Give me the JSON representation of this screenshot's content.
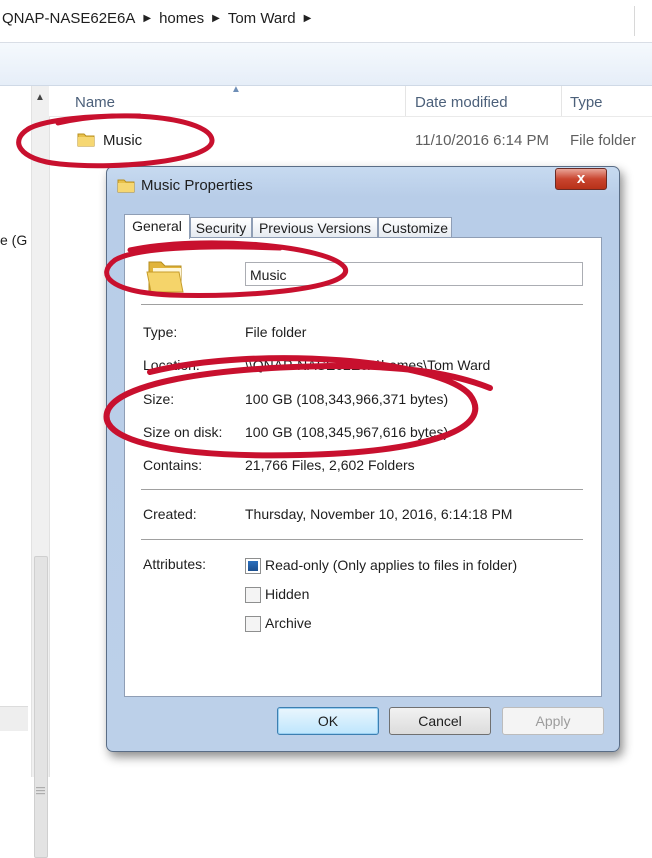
{
  "address": {
    "crumbs": [
      "QNAP-NASE62E6A",
      "homes",
      "Tom Ward"
    ]
  },
  "nav": {
    "partial_text": "e (G"
  },
  "columns": {
    "name": "Name",
    "date_modified": "Date modified",
    "type": "Type"
  },
  "file_row": {
    "name": "Music",
    "date": "11/10/2016 6:14 PM",
    "type": "File folder"
  },
  "dialog": {
    "title": "Music Properties",
    "close_label": "x",
    "tabs": [
      "General",
      "Security",
      "Previous Versions",
      "Customize"
    ],
    "folder_name": "Music",
    "labels": {
      "type": "Type:",
      "location": "Location:",
      "size": "Size:",
      "size_on_disk": "Size on disk:",
      "contains": "Contains:",
      "created": "Created:",
      "attributes": "Attributes:"
    },
    "values": {
      "type": "File folder",
      "location": "\\\\QNAP-NASE62E6A\\homes\\Tom Ward",
      "size": "100 GB (108,343,966,371 bytes)",
      "size_on_disk": "100 GB (108,345,967,616 bytes)",
      "contains": "21,766 Files, 2,602 Folders",
      "created": "Thursday, November 10, 2016, 6:14:18 PM"
    },
    "attributes": [
      {
        "label": "Read-only (Only applies to files in folder)",
        "state": "indeterminate"
      },
      {
        "label": "Hidden",
        "state": "unchecked"
      },
      {
        "label": "Archive",
        "state": "unchecked"
      }
    ],
    "buttons": {
      "ok": "OK",
      "cancel": "Cancel",
      "apply": "Apply"
    }
  },
  "colors": {
    "annotation_red": "#c8102e",
    "folder_yellow": "#e8c04a"
  }
}
